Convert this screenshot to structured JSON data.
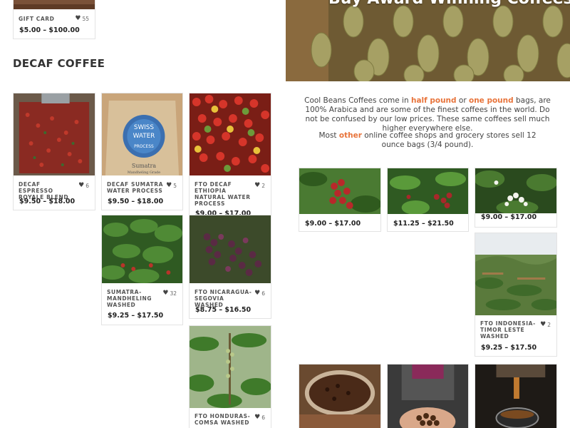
{
  "hero": {
    "title": "Buy Award Winning Coffees"
  },
  "intro": {
    "p1_before": "Cool Beans Coffees come in ",
    "p1_hl1": "half pound",
    "p1_mid": " or ",
    "p1_hl2": "one pound",
    "p1_after": " bags, are 100% Arabica and are some of the finest coffees in the world. Do not be confused by our low prices. These same coffees sell much higher everywhere else.",
    "p2_before": "Most ",
    "p2_hl": "other",
    "p2_after": " online coffee shops and grocery stores sell 12 ounce bags (3/4 pound)."
  },
  "section": {
    "title": "DECAF COFFEE"
  },
  "gift_card": {
    "name": "GIFT CARD",
    "likes": "55",
    "price": "$5.00 – $100.00"
  },
  "decaf_products": [
    {
      "name": "DECAF ESPRESSO ROYALE BLEND",
      "likes": "6",
      "price": "$9.50 – $18.00"
    },
    {
      "name": "DECAF SUMATRA WATER PROCESS",
      "likes": "5",
      "price": "$9.50 – $18.00"
    },
    {
      "name": "FTO DECAF ETHIOPIA NATURAL WATER PROCESS",
      "likes": "2",
      "price": "$9.00 – $17.00"
    },
    {
      "name": "SUMATRA-MANDHELING WASHED",
      "likes": "32",
      "price": "$9.25 – $17.50"
    },
    {
      "name": "FTO NICARAGUA-SEGOVIA WASHED",
      "likes": "6",
      "price": "$8.75 – $16.50"
    },
    {
      "name": "FTO HONDURAS-COMSA WASHED",
      "likes": "6",
      "price": ""
    }
  ],
  "right_products": [
    {
      "name": "",
      "price": "$9.00 – $17.00"
    },
    {
      "name": "",
      "price": "$11.25 – $21.50"
    },
    {
      "name": "",
      "price": "$9.00 – $17.00"
    },
    {
      "name": "FTO INDONESIA-TIMOR LESTE WASHED",
      "likes": "2",
      "price": "$9.25 – $17.50"
    }
  ],
  "swiss_water_bag": {
    "line1": "SWISS",
    "line2": "WATER",
    "line3": "PROCESS",
    "bag_label": "Sumatra",
    "bag_sub": "Mandheling Grade"
  },
  "colors": {
    "accent": "#e8743b",
    "card_border": "#e3e3e3",
    "text_dark": "#222222"
  },
  "icons": {
    "like": "heart-icon"
  }
}
